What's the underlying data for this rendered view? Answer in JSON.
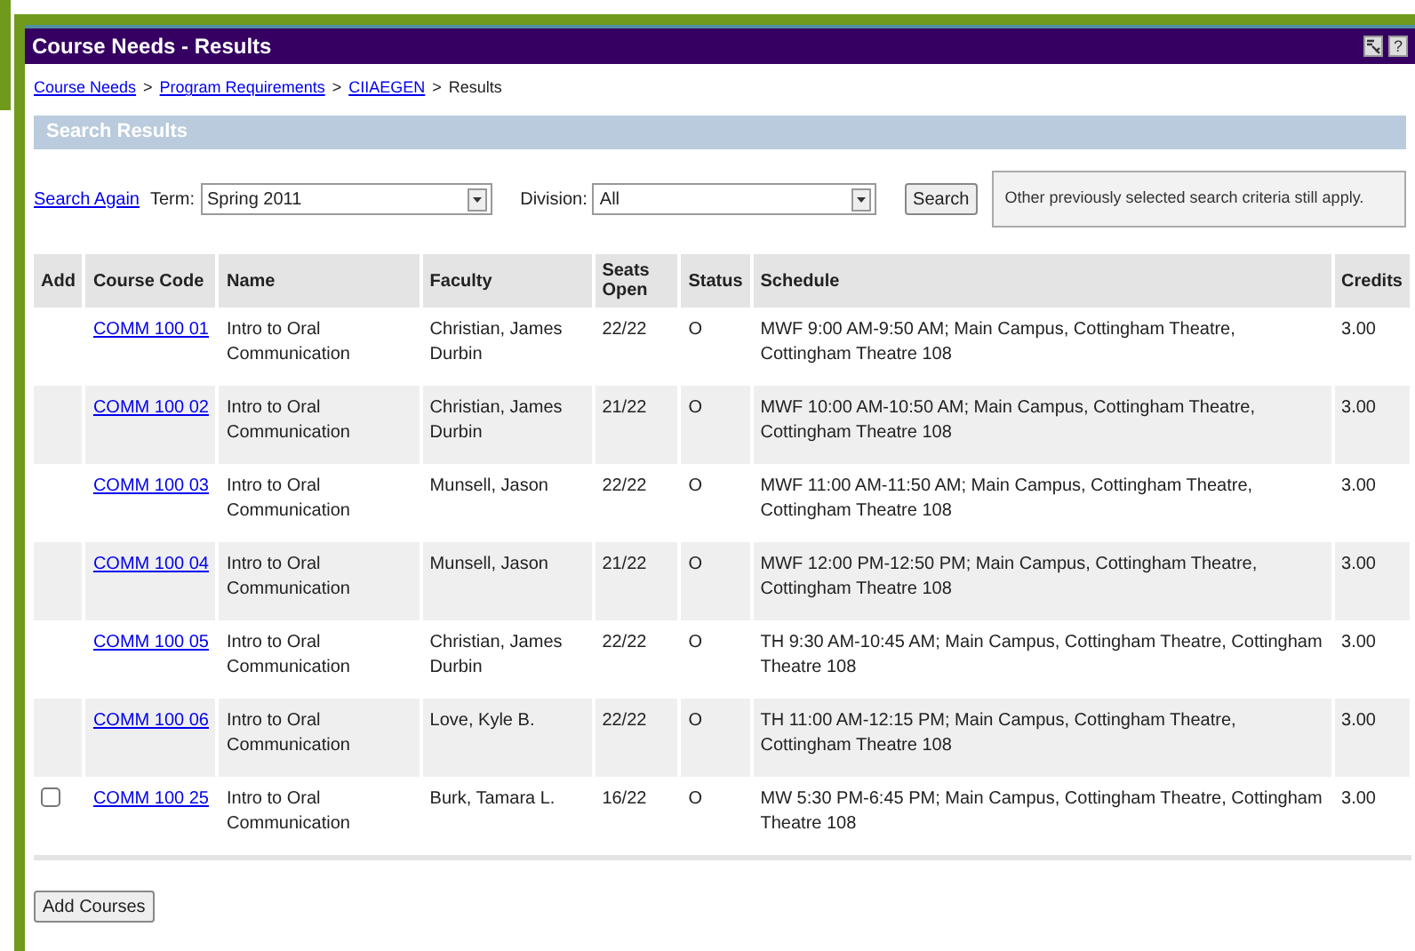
{
  "window": {
    "title": "Course Needs - Results"
  },
  "breadcrumb": [
    {
      "label": "Course Needs",
      "link": true
    },
    {
      "label": "Program Requirements",
      "link": true
    },
    {
      "label": "CIIAEGEN",
      "link": true
    },
    {
      "label": "Results",
      "link": false
    }
  ],
  "breadcrumb_separator": ">",
  "section_title": "Search Results",
  "search": {
    "search_again": "Search Again",
    "term_label": "Term:",
    "term_value": "Spring 2011",
    "division_label": "Division:",
    "division_value": "All",
    "search_button": "Search",
    "note": "Other previously selected search criteria still apply."
  },
  "table": {
    "columns": [
      "Add",
      "Course Code",
      "Name",
      "Faculty",
      "Seats Open",
      "Status",
      "Schedule",
      "Credits"
    ],
    "rows": [
      {
        "addable": false,
        "code": "COMM 100 01",
        "name": "Intro to Oral Communication",
        "faculty": "Christian, James Durbin",
        "seats": "22/22",
        "status": "O",
        "schedule": "MWF 9:00 AM-9:50 AM; Main Campus, Cottingham Theatre, Cottingham Theatre 108",
        "credits": "3.00"
      },
      {
        "addable": false,
        "code": "COMM 100 02",
        "name": "Intro to Oral Communication",
        "faculty": "Christian, James Durbin",
        "seats": "21/22",
        "status": "O",
        "schedule": "MWF 10:00 AM-10:50 AM; Main Campus, Cottingham Theatre, Cottingham Theatre 108",
        "credits": "3.00"
      },
      {
        "addable": false,
        "code": "COMM 100 03",
        "name": "Intro to Oral Communication",
        "faculty": "Munsell, Jason",
        "seats": "22/22",
        "status": "O",
        "schedule": "MWF 11:00 AM-11:50 AM; Main Campus, Cottingham Theatre, Cottingham Theatre 108",
        "credits": "3.00"
      },
      {
        "addable": false,
        "code": "COMM 100 04",
        "name": "Intro to Oral Communication",
        "faculty": "Munsell, Jason",
        "seats": "21/22",
        "status": "O",
        "schedule": "MWF 12:00 PM-12:50 PM; Main Campus, Cottingham Theatre, Cottingham Theatre 108",
        "credits": "3.00"
      },
      {
        "addable": false,
        "code": "COMM 100 05",
        "name": "Intro to Oral Communication",
        "faculty": "Christian, James Durbin",
        "seats": "22/22",
        "status": "O",
        "schedule": "TH 9:30 AM-10:45 AM; Main Campus, Cottingham Theatre, Cottingham Theatre 108",
        "credits": "3.00"
      },
      {
        "addable": false,
        "code": "COMM 100 06",
        "name": "Intro to Oral Communication",
        "faculty": "Love, Kyle B.",
        "seats": "22/22",
        "status": "O",
        "schedule": "TH 11:00 AM-12:15 PM; Main Campus, Cottingham Theatre, Cottingham Theatre 108",
        "credits": "3.00"
      },
      {
        "addable": true,
        "checked": false,
        "code": "COMM 100 25",
        "name": "Intro to Oral Communication",
        "faculty": "Burk, Tamara L.",
        "seats": "16/22",
        "status": "O",
        "schedule": "MW 5:30 PM-6:45 PM; Main Campus, Cottingham Theatre, Cottingham Theatre 108",
        "credits": "3.00"
      }
    ]
  },
  "add_button": "Add Courses",
  "help_icon": "?"
}
